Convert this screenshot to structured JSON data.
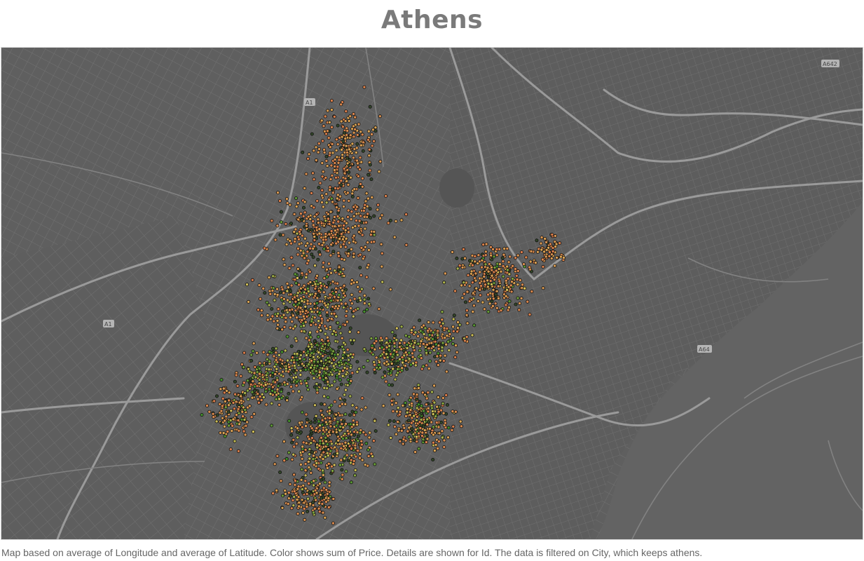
{
  "title": "Athens",
  "caption": "Map based on average of Longitude and average of Latitude.  Color shows sum of Price.  Details are shown for Id. The data is filtered on City, which keeps athens.",
  "road_shields": [
    "A1",
    "A1",
    "A642",
    "A64"
  ],
  "colors": {
    "background": "#5b5b5b",
    "land_block": "#6a6a6a",
    "street": "#7d7d7d",
    "highway": "#9a9a9a",
    "sea": "#636363",
    "price_low": "#3d8c2a",
    "price_mid": "#d9c25a",
    "price_high": "#d97a4a",
    "marker_outline": "#111111"
  },
  "color_legend_scale": [
    "low",
    "mid",
    "high"
  ]
}
